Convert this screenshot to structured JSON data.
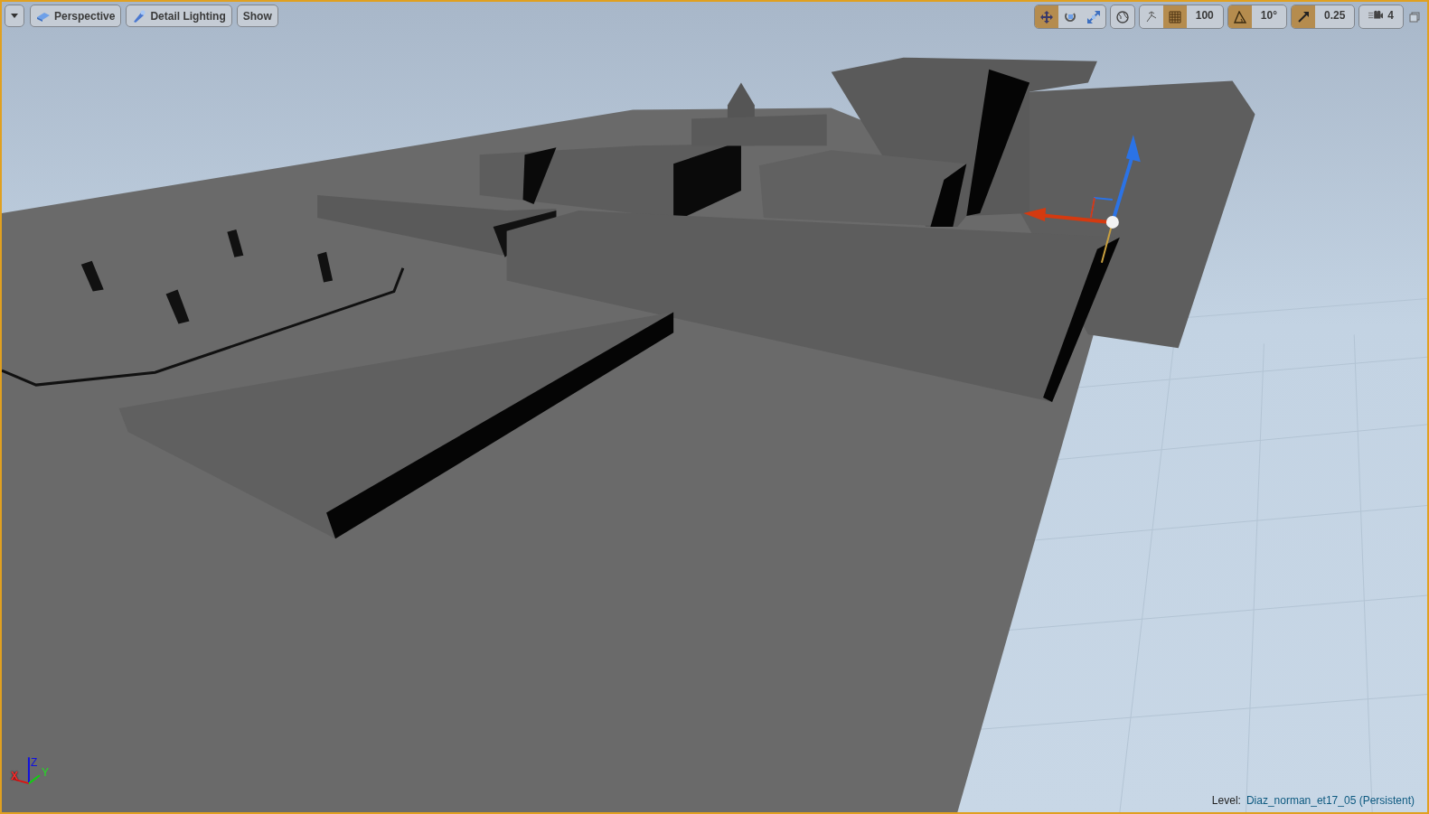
{
  "view_buttons": [
    {
      "kind": "perspective",
      "label": "Perspective"
    },
    {
      "kind": "lighting",
      "label": "Detail Lighting"
    },
    {
      "kind": "plain",
      "label": "Show"
    }
  ],
  "transform_tools": [
    {
      "kind": "translate",
      "selected": true
    },
    {
      "kind": "rotate",
      "selected": false
    },
    {
      "kind": "scale",
      "selected": false
    }
  ],
  "surface_snapping": {
    "on": false
  },
  "snaps": [
    {
      "kind": "grid",
      "on": true,
      "value": "100"
    },
    {
      "kind": "rotation",
      "on": true,
      "value": "10°"
    },
    {
      "kind": "scale",
      "on": true,
      "value": "0.25"
    }
  ],
  "camera_speed": "4",
  "axis_labels": [
    "X",
    "Y",
    "Z"
  ],
  "level": {
    "label": "Level:",
    "name": "Diaz_norman_et17_05 (Persistent)"
  }
}
